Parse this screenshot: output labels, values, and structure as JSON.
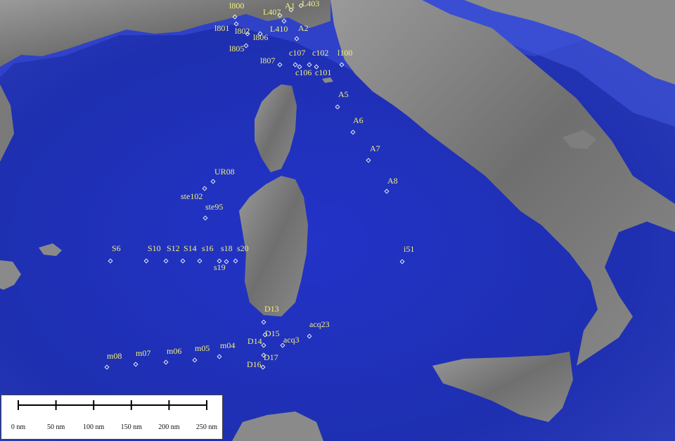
{
  "colors": {
    "sea": "#1e2fb0",
    "land": "#7d7d7d",
    "marker": "#ffffff",
    "label": "#f2f07a"
  },
  "stations": [
    {
      "label": "l800"
    },
    {
      "label": "L407"
    },
    {
      "label": "A1"
    },
    {
      "label": "L403"
    },
    {
      "label": "l801"
    },
    {
      "label": "l802"
    },
    {
      "label": "l806"
    },
    {
      "label": "L410"
    },
    {
      "label": "A2"
    },
    {
      "label": "l805"
    },
    {
      "label": "l807"
    },
    {
      "label": "c107"
    },
    {
      "label": "c102"
    },
    {
      "label": "l100"
    },
    {
      "label": "c106"
    },
    {
      "label": "c101"
    },
    {
      "label": "A5"
    },
    {
      "label": "A6"
    },
    {
      "label": "A7"
    },
    {
      "label": "A8"
    },
    {
      "label": "UR08"
    },
    {
      "label": "ste102"
    },
    {
      "label": "ste95"
    },
    {
      "label": "S6"
    },
    {
      "label": "S10"
    },
    {
      "label": "S12"
    },
    {
      "label": "S14"
    },
    {
      "label": "s16"
    },
    {
      "label": "s18"
    },
    {
      "label": "s20"
    },
    {
      "label": "s19"
    },
    {
      "label": "i51"
    },
    {
      "label": "D13"
    },
    {
      "label": "acq23"
    },
    {
      "label": "D15"
    },
    {
      "label": "acq3"
    },
    {
      "label": "D14"
    },
    {
      "label": "m08"
    },
    {
      "label": "m07"
    },
    {
      "label": "m06"
    },
    {
      "label": "m05"
    },
    {
      "label": "m04"
    },
    {
      "label": "D17"
    },
    {
      "label": "D16"
    }
  ],
  "scale_bar": {
    "ticks": [
      "0 nm",
      "50 nm",
      "100 nm",
      "150 nm",
      "200 nm",
      "250 nm"
    ]
  }
}
